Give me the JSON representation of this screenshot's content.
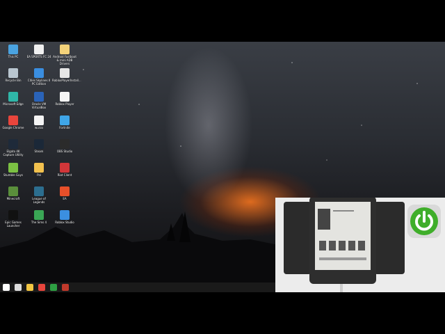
{
  "desktop": {
    "icons": [
      {
        "label": "This PC",
        "icon": "computer-icon",
        "color": "#4aa3e0"
      },
      {
        "label": "EA SPORTS FC 24",
        "icon": "ea-fc-icon",
        "color": "#f0f0f0"
      },
      {
        "label": "Android Fastboot & mini ADB Drivers",
        "icon": "folder-icon",
        "color": "#f3d27a"
      },
      {
        "label": "Recycle Bin",
        "icon": "recycle-bin-icon",
        "color": "#b9c6d0"
      },
      {
        "label": "Cities Skylines II PC Edition",
        "icon": "cities-skylines-icon",
        "color": "#3a8ee0"
      },
      {
        "label": "RobloxPlayerInstall...",
        "icon": "roblox-installer-icon",
        "color": "#e6e6e6"
      },
      {
        "label": "Microsoft Edge",
        "icon": "edge-icon",
        "color": "#2fb6a8"
      },
      {
        "label": "Oracle VM VirtualBox",
        "icon": "virtualbox-icon",
        "color": "#2a63b8"
      },
      {
        "label": "Roblox Player",
        "icon": "roblox-icon",
        "color": "#f5f5f5"
      },
      {
        "label": "Google Chrome",
        "icon": "chrome-icon",
        "color": "#e8453c"
      },
      {
        "label": "wurzo",
        "icon": "file-icon",
        "color": "#f4f4f4"
      },
      {
        "label": "Fortnite",
        "icon": "fortnite-icon",
        "color": "#3fa6e8"
      },
      {
        "label": "Elgato 4K Capture Utility",
        "icon": "elgato-icon",
        "color": "#1e2a3a"
      },
      {
        "label": "Steam",
        "icon": "steam-icon",
        "color": "#1b2838"
      },
      {
        "label": "OBS Studio",
        "icon": "obs-icon",
        "color": "#2b2b2b"
      },
      {
        "label": "Stumble Guys",
        "icon": "stumble-guys-icon",
        "color": "#7bc043"
      },
      {
        "label": "Pal",
        "icon": "pal-icon",
        "color": "#f2c14e"
      },
      {
        "label": "Riot Client",
        "icon": "riot-icon",
        "color": "#d13639"
      },
      {
        "label": "Minecraft",
        "icon": "minecraft-icon",
        "color": "#5a8f3b"
      },
      {
        "label": "League of Legends",
        "icon": "league-icon",
        "color": "#2c6e8f"
      },
      {
        "label": "EA",
        "icon": "ea-icon",
        "color": "#e8502a"
      },
      {
        "label": "Epic Games Launcher",
        "icon": "epic-games-icon",
        "color": "#111111"
      },
      {
        "label": "The Sims 4",
        "icon": "sims-icon",
        "color": "#3aa655"
      },
      {
        "label": "Roblox Studio",
        "icon": "roblox-studio-icon",
        "color": "#3b8fe0"
      }
    ]
  },
  "taskbar": {
    "items": [
      {
        "name": "start-button",
        "icon": "windows-icon",
        "color": "#ffffff"
      },
      {
        "name": "task-view-button",
        "icon": "task-view-icon",
        "color": "#dddddd"
      },
      {
        "name": "file-explorer-button",
        "icon": "folder-icon",
        "color": "#f3c642"
      },
      {
        "name": "chrome-taskbar-button",
        "icon": "chrome-icon",
        "color": "#e8453c"
      },
      {
        "name": "xbox-taskbar-button",
        "icon": "xbox-icon",
        "color": "#2ea043"
      },
      {
        "name": "recording-taskbar-button",
        "icon": "record-icon",
        "color": "#c0392b"
      }
    ]
  },
  "webcam": {
    "logo_icon": "power-icon",
    "logo_color": "#3fae2a"
  }
}
